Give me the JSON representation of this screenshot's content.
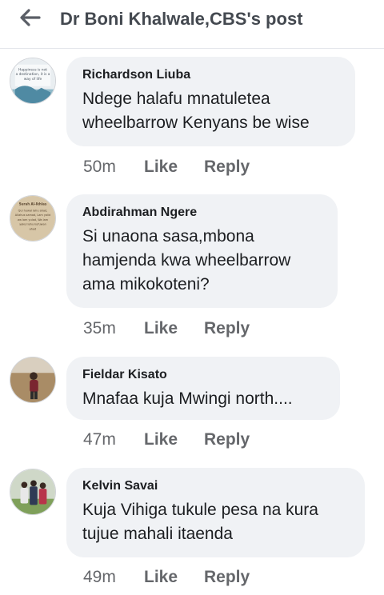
{
  "header": {
    "back_icon": "arrow-left-icon",
    "title": "Dr Boni Khalwale,CBS's post"
  },
  "comments": [
    {
      "author": "Richardson Liuba",
      "lines": [
        "Ndege halafu mnatuletea",
        "wheelbarrow Kenyans be wise"
      ],
      "time": "50m",
      "like": "Like",
      "reply": "Reply",
      "avatar_text": [
        "Happiness is not",
        "a destination, it is a",
        "way of life"
      ]
    },
    {
      "author": "Abdirahman Ngere",
      "lines": [
        "Si unaona sasa,mbona",
        "hamjenda kwa wheelbarrow",
        "ama mikokoteni?"
      ],
      "time": "35m",
      "like": "Like",
      "reply": "Reply",
      "avatar_text": [
        "Surah Al-Ikhlas",
        "Qul huwal lahu ahad,",
        "Allahus samad, Lam yalid",
        "wa lam yulad, Wa lam",
        "yakul lahu kufuwan",
        "ahad"
      ]
    },
    {
      "author": "Fieldar Kisato",
      "lines": [
        "Mnafaa kuja Mwingi north...."
      ],
      "time": "47m",
      "like": "Like",
      "reply": "Reply"
    },
    {
      "author": "Kelvin Savai",
      "lines": [
        "Kuja Vihiga tukule pesa na kura",
        "tujue mahali itaenda"
      ],
      "time": "49m",
      "like": "Like",
      "reply": "Reply"
    }
  ]
}
